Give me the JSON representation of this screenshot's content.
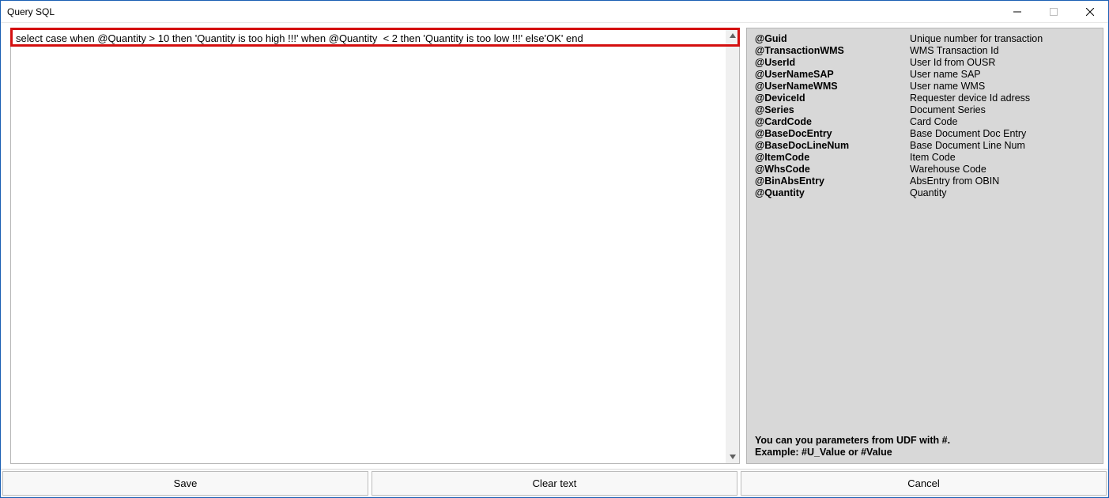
{
  "window": {
    "title": "Query SQL"
  },
  "editor": {
    "value": "select case when @Quantity > 10 then 'Quantity is too high !!!' when @Quantity  < 2 then 'Quantity is too low !!!' else'OK' end"
  },
  "help": {
    "params": [
      {
        "key": "@Guid",
        "desc": "Unique number for transaction"
      },
      {
        "key": "@TransactionWMS",
        "desc": "WMS Transaction Id"
      },
      {
        "key": "@UserId",
        "desc": "User Id from OUSR"
      },
      {
        "key": "@UserNameSAP",
        "desc": "User name SAP"
      },
      {
        "key": "@UserNameWMS",
        "desc": "User name WMS"
      },
      {
        "key": "@DeviceId",
        "desc": "Requester device Id adress"
      },
      {
        "key": "@Series",
        "desc": "Document Series"
      },
      {
        "key": "@CardCode",
        "desc": "Card Code"
      },
      {
        "key": "@BaseDocEntry",
        "desc": "Base Document Doc Entry"
      },
      {
        "key": "@BaseDocLineNum",
        "desc": "Base Document Line Num"
      },
      {
        "key": "@ItemCode",
        "desc": "Item Code"
      },
      {
        "key": "@WhsCode",
        "desc": "Warehouse Code"
      },
      {
        "key": "@BinAbsEntry",
        "desc": "AbsEntry from OBIN"
      },
      {
        "key": "@Quantity",
        "desc": "Quantity"
      }
    ],
    "note_line1": "You can you parameters from UDF with #.",
    "note_line2": "Example: #U_Value or #Value"
  },
  "buttons": {
    "save": "Save",
    "clear": "Clear text",
    "cancel": "Cancel"
  }
}
